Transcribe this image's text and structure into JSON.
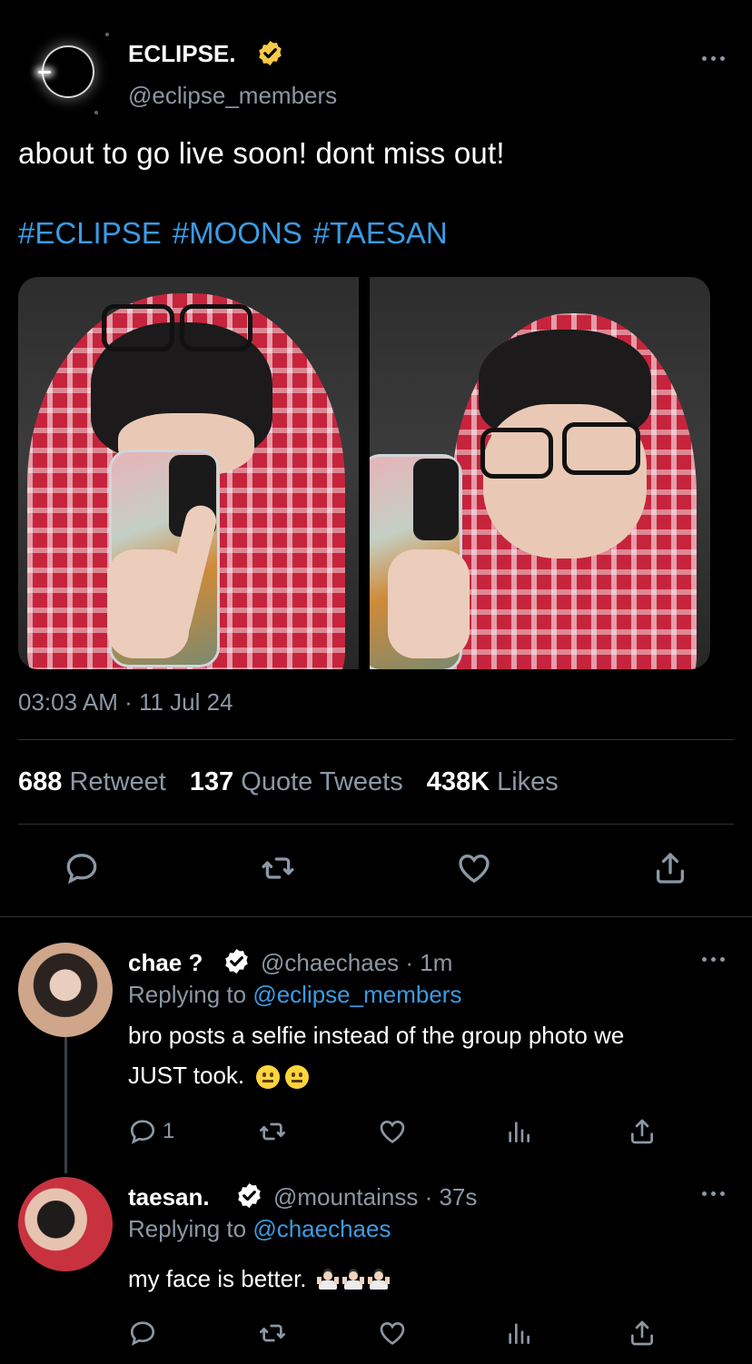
{
  "tweet": {
    "author_name": "ECLIPSE.",
    "author_handle": "@eclipse_members",
    "text": "about to go live soon! dont miss out!",
    "hashtags": [
      "#ECLIPSE",
      "#MOONS",
      "#TAESAN"
    ],
    "timestamp": "03:03 AM · 11 Jul 24",
    "stats": {
      "retweets_count": "688",
      "retweets_label": "Retweet",
      "quotes_count": "137",
      "quotes_label": "Quote Tweets",
      "likes_count": "438K",
      "likes_label": "Likes"
    }
  },
  "replies": [
    {
      "name": "chae ?",
      "handle": "@chaechaes",
      "time": "1m",
      "replying_label": "Replying to",
      "replying_to": "@eclipse_members",
      "text_line1": "bro posts a selfie instead of the group photo we",
      "text_line2": "JUST took.",
      "reply_count": "1"
    },
    {
      "name": "taesan.",
      "handle": "@mountainss",
      "time": "37s",
      "replying_label": "Replying to",
      "replying_to": "@chaechaes",
      "text": "my face is better."
    }
  ],
  "colors": {
    "link": "#3b9be3",
    "muted": "#8b98a5",
    "gold_badge": "#f7c948",
    "divider": "#2f3336"
  },
  "icons": [
    "more-icon",
    "verified-gold-icon",
    "verified-icon",
    "reply-icon",
    "retweet-icon",
    "like-icon",
    "share-icon",
    "views-icon"
  ]
}
